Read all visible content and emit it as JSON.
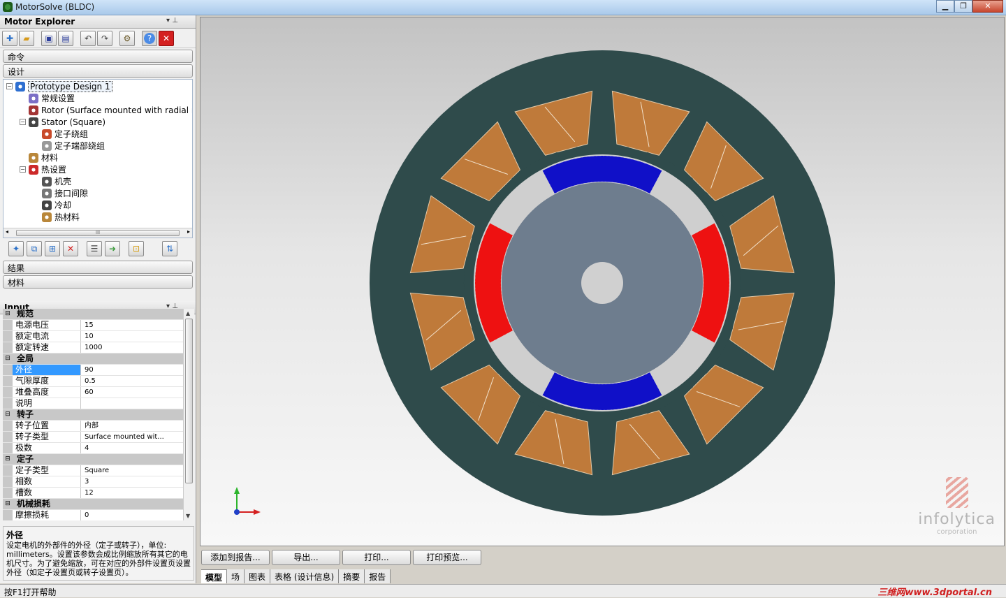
{
  "window": {
    "title": "MotorSolve (BLDC)",
    "minimize": "▁",
    "maximize": "❐",
    "close": "✕"
  },
  "explorer": {
    "title": "Motor Explorer",
    "pin": "▾  ⊥",
    "toolbar": [
      "new-icon",
      "open-icon",
      "save-icon",
      "save-as-icon",
      "undo-icon",
      "redo-icon",
      "settings-icon",
      "help-icon",
      "close-icon"
    ],
    "sections": {
      "commands": "命令",
      "design": "设计",
      "results": "结果",
      "materials": "材料"
    },
    "tree": [
      {
        "label": "Prototype Design 1",
        "indent": 0,
        "exp": "−",
        "color": "#2e6fd1",
        "selected": true
      },
      {
        "label": "常规设置",
        "indent": 1,
        "exp": "",
        "color": "#7b6fc6"
      },
      {
        "label": "Rotor (Surface mounted with radial magnets)",
        "indent": 1,
        "exp": "",
        "color": "#a33434"
      },
      {
        "label": "Stator (Square)",
        "indent": 1,
        "exp": "−",
        "color": "#444444"
      },
      {
        "label": "定子绕组",
        "indent": 2,
        "exp": "",
        "color": "#c94b2b"
      },
      {
        "label": "定子端部绕组",
        "indent": 2,
        "exp": "",
        "color": "#999999"
      },
      {
        "label": "材料",
        "indent": 1,
        "exp": "",
        "color": "#b9873a"
      },
      {
        "label": "热设置",
        "indent": 1,
        "exp": "−",
        "color": "#cc2a2a"
      },
      {
        "label": "机壳",
        "indent": 2,
        "exp": "",
        "color": "#555555"
      },
      {
        "label": "接口间隙",
        "indent": 2,
        "exp": "",
        "color": "#777777"
      },
      {
        "label": "冷却",
        "indent": 2,
        "exp": "",
        "color": "#444444"
      },
      {
        "label": "热材料",
        "indent": 2,
        "exp": "",
        "color": "#b9873a"
      }
    ],
    "scroll_thumb": "III"
  },
  "input": {
    "title": "Input",
    "rows": [
      {
        "type": "cat",
        "name": "规范"
      },
      {
        "type": "prop",
        "name": "电源电压",
        "value": "15"
      },
      {
        "type": "prop",
        "name": "额定电流",
        "value": "10"
      },
      {
        "type": "prop",
        "name": "额定转速",
        "value": "1000"
      },
      {
        "type": "cat",
        "name": "全局"
      },
      {
        "type": "prop",
        "name": "外径",
        "value": "90",
        "selected": true
      },
      {
        "type": "prop",
        "name": "气隙厚度",
        "value": "0.5"
      },
      {
        "type": "prop",
        "name": "堆叠高度",
        "value": "60"
      },
      {
        "type": "prop",
        "name": "说明",
        "value": ""
      },
      {
        "type": "cat",
        "name": "转子"
      },
      {
        "type": "prop",
        "name": "转子位置",
        "value": "内部"
      },
      {
        "type": "prop",
        "name": "转子类型",
        "value": "Surface mounted wit..."
      },
      {
        "type": "prop",
        "name": "极数",
        "value": "4"
      },
      {
        "type": "cat",
        "name": "定子"
      },
      {
        "type": "prop",
        "name": "定子类型",
        "value": "Square"
      },
      {
        "type": "prop",
        "name": "相数",
        "value": "3"
      },
      {
        "type": "prop",
        "name": "槽数",
        "value": "12"
      },
      {
        "type": "cat",
        "name": "机械损耗"
      },
      {
        "type": "prop",
        "name": "摩擦损耗",
        "value": "0"
      }
    ]
  },
  "description": {
    "title": "外径",
    "text": "设定电机的外部件的外径（定子或转子），单位: millimeters。设置该参数会成比例缩放所有其它的电机尺寸。为了避免缩放，可在对应的外部件设置页设置外径（如定子设置页或转子设置页）。"
  },
  "view": {
    "watermark": {
      "name": "infolytica",
      "sub": "corporation"
    },
    "colors": {
      "stator": "#2f4b4b",
      "slot": "#bf7a3a",
      "rotor_core": "#6e7d8e",
      "shaft": "#d0d0d0",
      "gap": "#cfcfcf",
      "magnet_n": "#ee1111",
      "magnet_s": "#1010c8"
    }
  },
  "buttons": {
    "add_report": "添加到报告...",
    "export": "导出...",
    "print": "打印...",
    "print_preview": "打印预览..."
  },
  "tabs": [
    "模型",
    "场",
    "图表",
    "表格 (设计信息)",
    "摘要",
    "报告"
  ],
  "status": {
    "text": "按F1打开帮助",
    "site": "三维网www.3dportal.cn"
  }
}
